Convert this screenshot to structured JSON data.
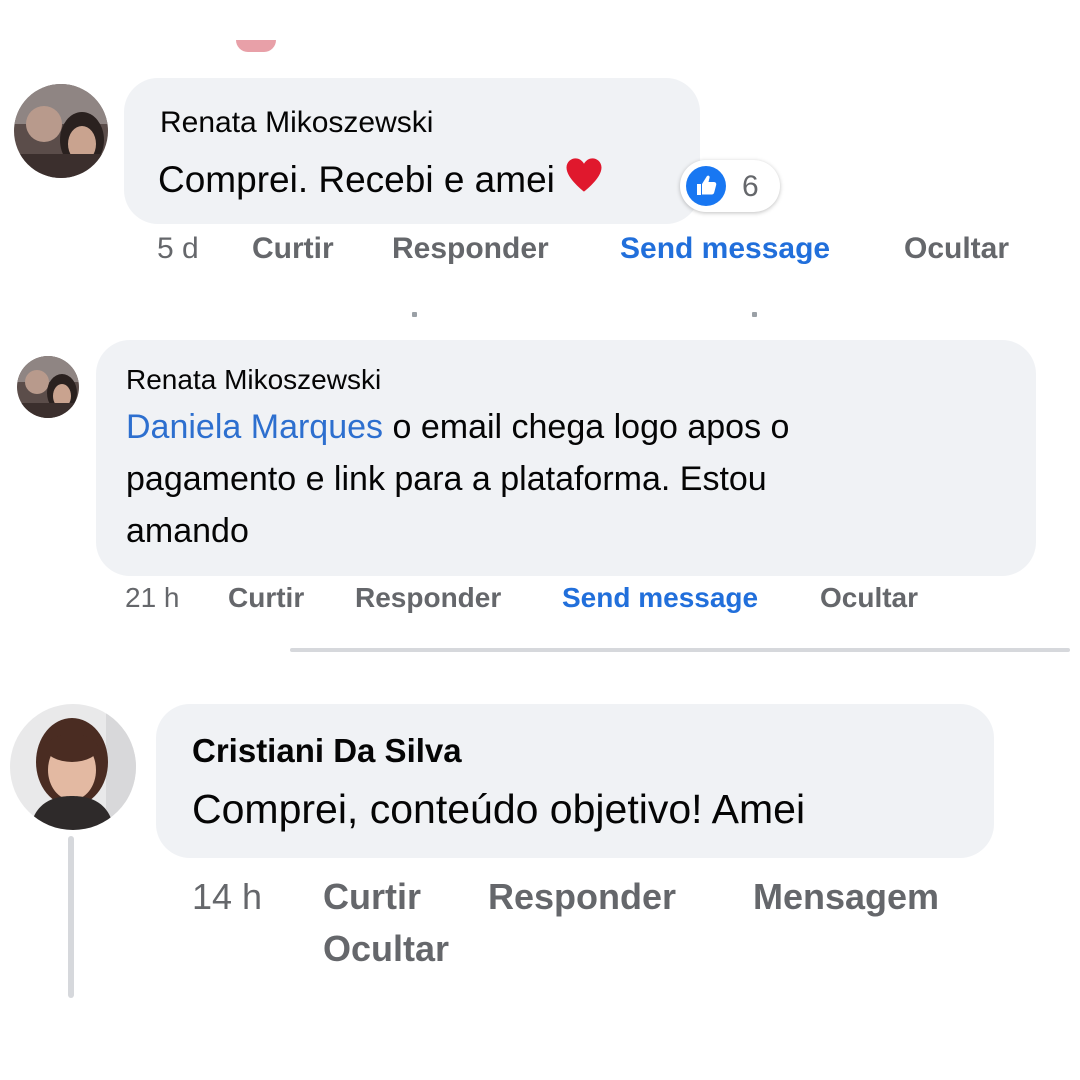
{
  "comments": [
    {
      "author": "Renata Mikoszewski",
      "text": "Comprei. Recebi e amei",
      "emoji": "heart-emoji",
      "reaction": {
        "icon": "like-icon",
        "count": "6"
      },
      "time": "5 d",
      "actions": {
        "like": "Curtir",
        "reply": "Responder",
        "message": "Send message",
        "hide": "Ocultar"
      }
    },
    {
      "author": "Renata Mikoszewski",
      "mention": "Daniela Marques",
      "text_line1": " o email chega logo apos o",
      "text_line2": "pagamento e link para a plataforma. Estou",
      "text_line3": "amando",
      "time": "21 h",
      "actions": {
        "like": "Curtir",
        "reply": "Responder",
        "message": "Send message",
        "hide": "Ocultar"
      }
    },
    {
      "author": "Cristiani Da Silva",
      "text": "Comprei, conteúdo objetivo! Amei",
      "time": "14 h",
      "actions": {
        "like": "Curtir",
        "reply": "Responder",
        "message": "Mensagem",
        "hide": "Ocultar"
      }
    }
  ],
  "colors": {
    "bubble": "#f0f2f5",
    "link": "#216fdb",
    "muted": "#65676b",
    "like": "#1877f2",
    "heart": "#e0182d"
  }
}
